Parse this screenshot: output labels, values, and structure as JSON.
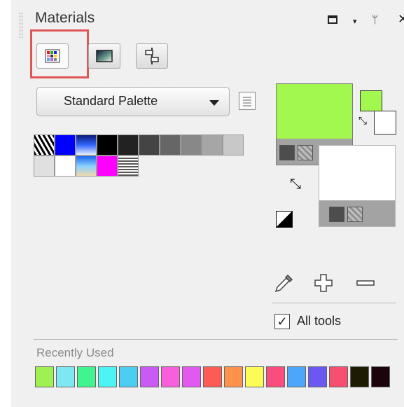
{
  "panel": {
    "title": "Materials",
    "close_glyph": "✕",
    "pin_glyph": "ᛘ",
    "dropdown_glyph": "▾"
  },
  "tabs": [
    {
      "name": "swatches-tab",
      "icon": "grid-icon",
      "active": true
    },
    {
      "name": "gradient-tab",
      "icon": "gradient-icon",
      "active": false
    },
    {
      "name": "adjust-tab",
      "icon": "sliders-icon",
      "active": false
    }
  ],
  "palette_select": {
    "selected": "Standard Palette"
  },
  "palette_swatches_row1": [
    "pattern:zebra",
    "#0000ff",
    "gradient:blue",
    "#000000",
    "#222222",
    "#444444",
    "#666666",
    "#888888",
    "#a6a6a6",
    "#c8c8c8"
  ],
  "palette_swatches_row2": [
    "#e0e0e0",
    "#ffffff",
    "gradient:sky",
    "#ff00ff",
    "pattern:stripes"
  ],
  "colors": {
    "foreground": "#a2f84e",
    "background": "#ffffff",
    "highlight": "#e05656"
  },
  "tools": {
    "eyedropper_icon": "eyedropper-icon",
    "add_icon": "plus-icon",
    "remove_icon": "minus-icon"
  },
  "all_tools": {
    "label": "All tools",
    "checked": true
  },
  "recently_used": {
    "label": "Recently Used",
    "colors": [
      "#9ef150",
      "#7de8f3",
      "#42f48f",
      "#4cf4f3",
      "#4ccef3",
      "#c95af6",
      "#f85fdd",
      "#e159f1",
      "#fd5c55",
      "#fe914c",
      "#fdfb56",
      "#fb4d7d",
      "#4ca6f9",
      "#6b58f1",
      "#f74f6f",
      "#1d1c03",
      "#1d030c"
    ]
  }
}
